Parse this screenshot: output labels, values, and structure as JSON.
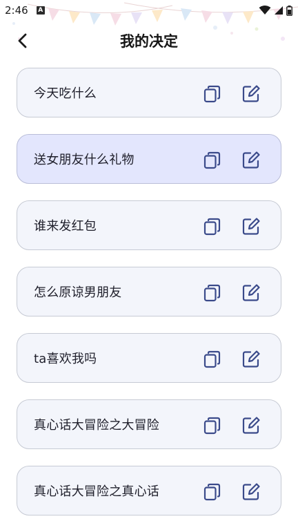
{
  "status_bar": {
    "time": "2:46",
    "notification_letter": "A"
  },
  "header": {
    "title": "我的决定"
  },
  "decisions": [
    {
      "label": "今天吃什么",
      "selected": false
    },
    {
      "label": "送女朋友什么礼物",
      "selected": true
    },
    {
      "label": "谁来发红包",
      "selected": false
    },
    {
      "label": "怎么原谅男朋友",
      "selected": false
    },
    {
      "label": "ta喜欢我吗",
      "selected": false
    },
    {
      "label": "真心话大冒险之大冒险",
      "selected": false
    },
    {
      "label": "真心话大冒险之真心话",
      "selected": false
    }
  ],
  "icons": {
    "back": "chevron-left-icon",
    "copy": "copy-icon",
    "edit": "edit-icon"
  },
  "colors": {
    "icon": "#3a4a8a",
    "card_bg": "#f3f5fb",
    "card_selected_bg": "#e3e6fd",
    "card_border": "#c6cad4"
  }
}
